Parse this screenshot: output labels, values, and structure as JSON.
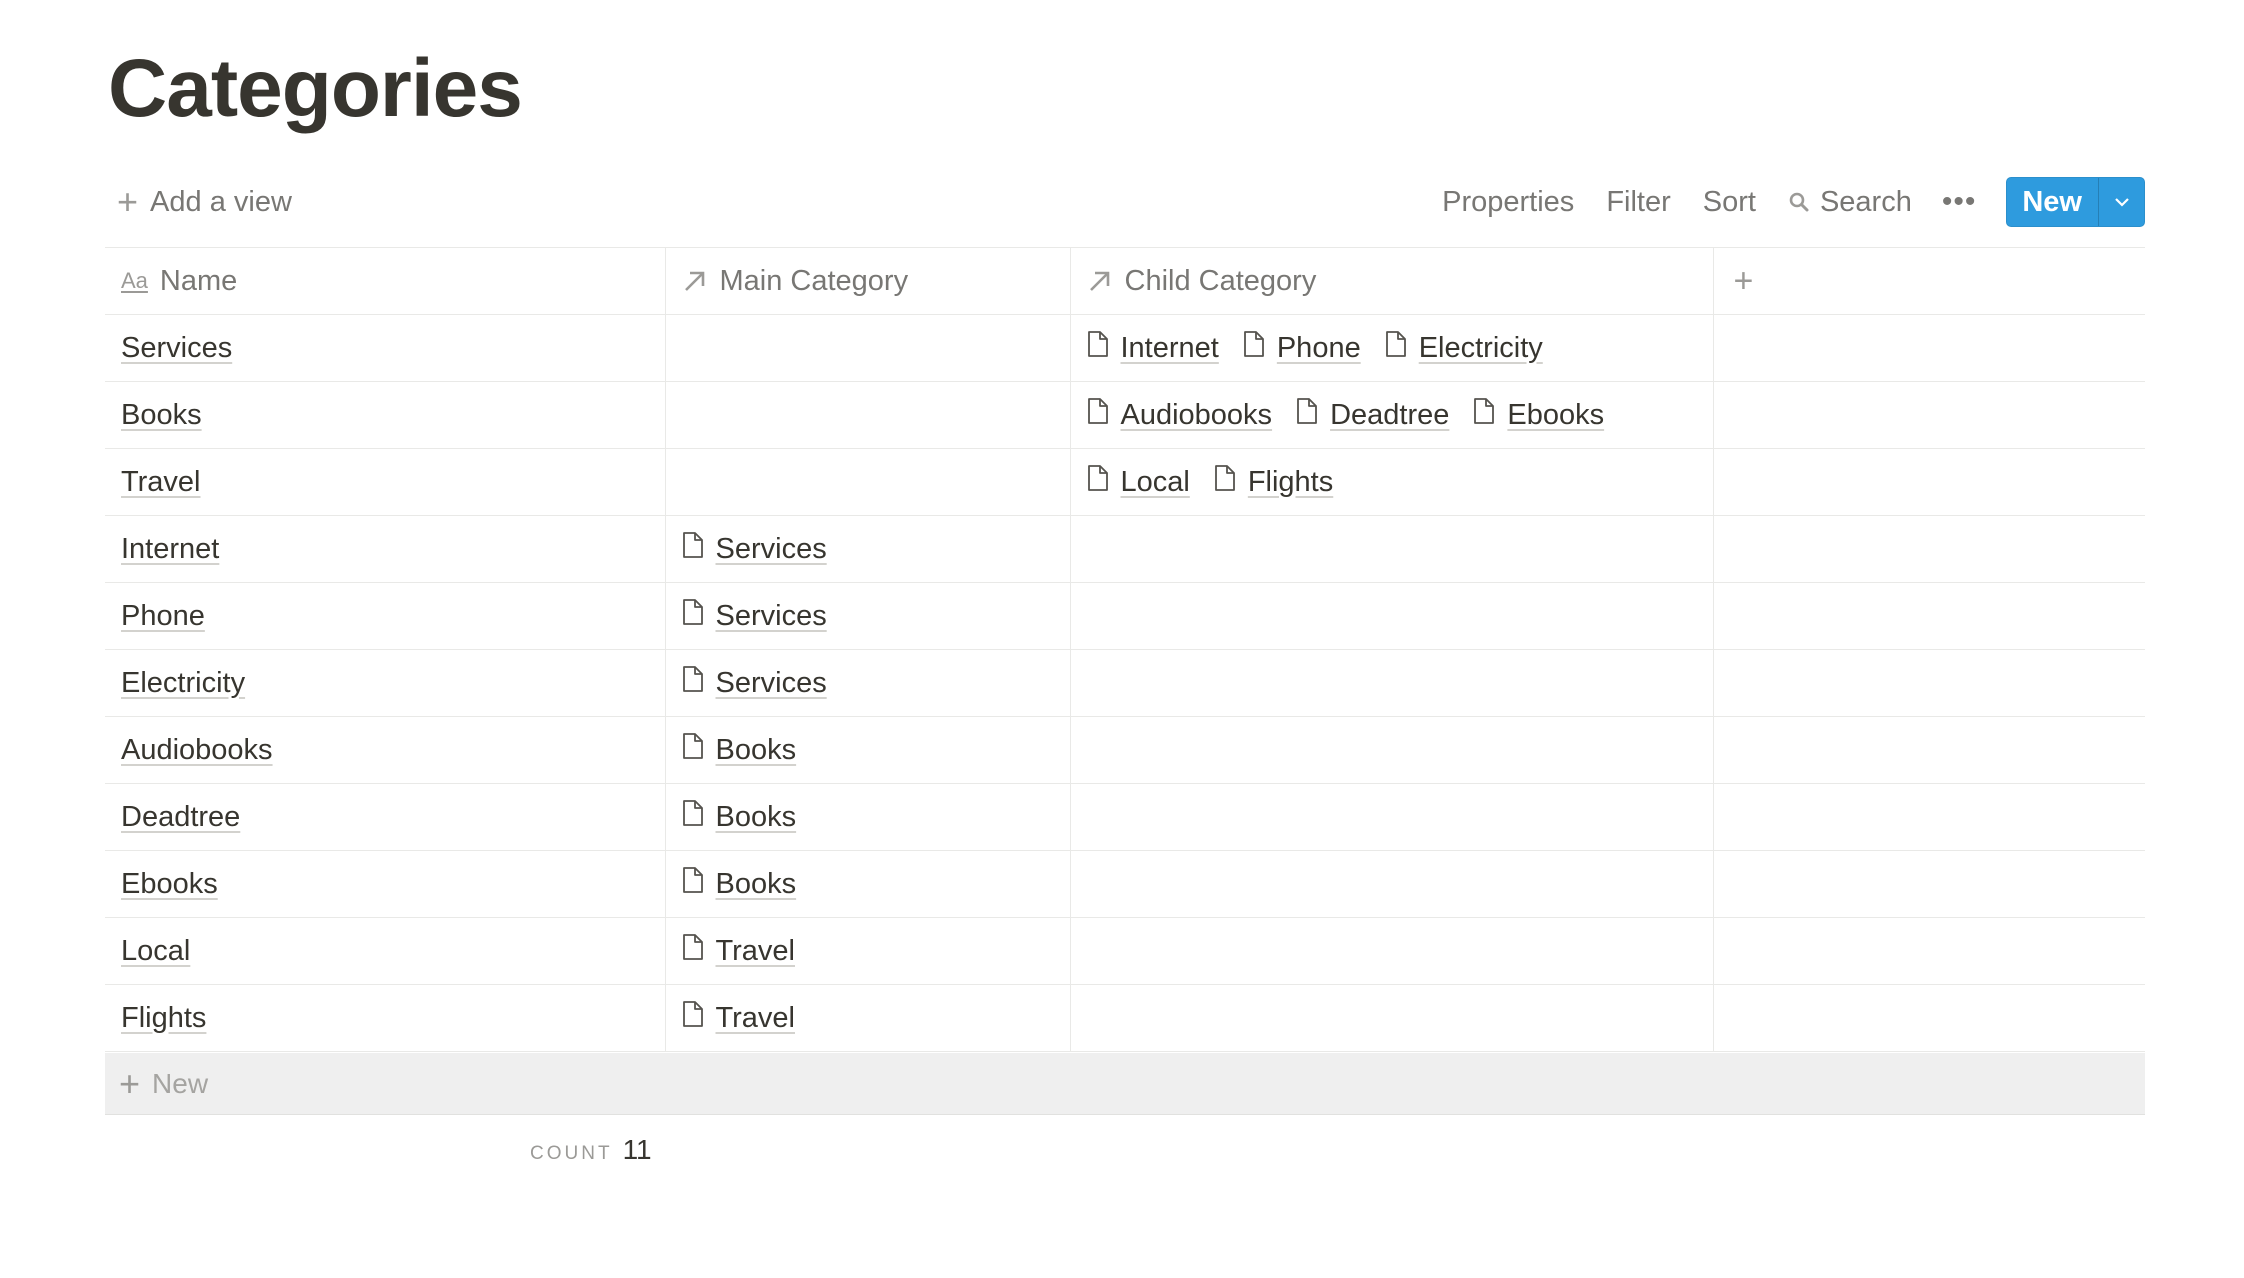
{
  "page": {
    "title": "Categories"
  },
  "toolbar": {
    "add_view_label": "Add a view",
    "properties_label": "Properties",
    "filter_label": "Filter",
    "sort_label": "Sort",
    "search_label": "Search",
    "more_label": "•••",
    "new_label": "New"
  },
  "table": {
    "columns": [
      "Name",
      "Main Category",
      "Child Category"
    ],
    "name_icon": "Aa",
    "rows": [
      {
        "name": "Services",
        "main": [],
        "children": [
          "Internet",
          "Phone",
          "Electricity"
        ]
      },
      {
        "name": "Books",
        "main": [],
        "children": [
          "Audiobooks",
          "Deadtree",
          "Ebooks"
        ]
      },
      {
        "name": "Travel",
        "main": [],
        "children": [
          "Local",
          "Flights"
        ]
      },
      {
        "name": "Internet",
        "main": [
          "Services"
        ],
        "children": []
      },
      {
        "name": "Phone",
        "main": [
          "Services"
        ],
        "children": []
      },
      {
        "name": "Electricity",
        "main": [
          "Services"
        ],
        "children": []
      },
      {
        "name": "Audiobooks",
        "main": [
          "Books"
        ],
        "children": []
      },
      {
        "name": "Deadtree",
        "main": [
          "Books"
        ],
        "children": []
      },
      {
        "name": "Ebooks",
        "main": [
          "Books"
        ],
        "children": []
      },
      {
        "name": "Local",
        "main": [
          "Travel"
        ],
        "children": []
      },
      {
        "name": "Flights",
        "main": [
          "Travel"
        ],
        "children": []
      }
    ],
    "new_row_label": "New",
    "count_label": "COUNT",
    "count_value": "11"
  },
  "colors": {
    "accent": "#2e9bde",
    "text": "#37352f",
    "muted": "#787774",
    "border": "#e9e9e7"
  }
}
